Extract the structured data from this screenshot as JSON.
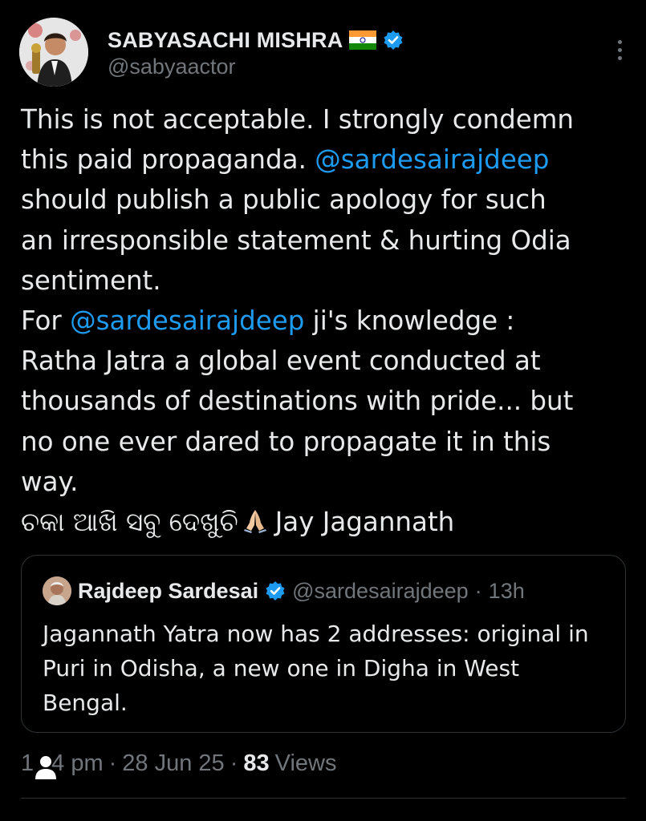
{
  "author": {
    "display_name": "SABYASACHI MISHRA",
    "flag": "india-flag-emoji",
    "verified": true,
    "handle": "@sabyaactor"
  },
  "tweet": {
    "lines": [
      [
        {
          "text": "This is not acceptable. I strongly condemn",
          "type": "text"
        }
      ],
      [
        {
          "text": "this paid propaganda. ",
          "type": "text"
        },
        {
          "text": "@sardesairajdeep",
          "type": "mention"
        }
      ],
      [
        {
          "text": "should publish a public apology for such",
          "type": "text"
        }
      ],
      [
        {
          "text": "an irresponsible statement & hurting Odia",
          "type": "text"
        }
      ],
      [
        {
          "text": "sentiment.",
          "type": "text"
        }
      ],
      [
        {
          "text": "For ",
          "type": "text"
        },
        {
          "text": "@sardesairajdeep",
          "type": "mention"
        },
        {
          "text": " ji's knowledge :",
          "type": "text"
        }
      ],
      [
        {
          "text": "Ratha Jatra a global event conducted at",
          "type": "text"
        }
      ],
      [
        {
          "text": "thousands of destinations with pride... but",
          "type": "text"
        }
      ],
      [
        {
          "text": "no one ever dared to propagate it in this",
          "type": "text"
        }
      ],
      [
        {
          "text": "way.",
          "type": "text"
        }
      ]
    ],
    "final_line": {
      "odia_text": "ଚକା ଆଖି ସବୁ ଦେଖୁଚି",
      "emoji": "folded-hands-icon",
      "tail_text": "Jay Jagannath"
    }
  },
  "quoted_tweet": {
    "display_name": "Rajdeep Sardesai",
    "verified": true,
    "handle": "@sardesairajdeep",
    "separator": "·",
    "time": "13h",
    "lines": [
      "Jagannath Yatra now has 2 addresses: original in",
      "Puri in Odisha, a new one in Digha in West",
      "Bengal."
    ]
  },
  "meta": {
    "time_visible": "1",
    "time_rest": "4 pm",
    "separator": "·",
    "date": "28 Jun 25",
    "views_count": "83",
    "views_label": "Views"
  },
  "colors": {
    "background": "#000000",
    "text_primary": "#e7e9ea",
    "text_secondary": "#71767b",
    "mention": "#1d9bf0",
    "verified_badge": "#1d9bf0",
    "border": "#2f3336"
  }
}
